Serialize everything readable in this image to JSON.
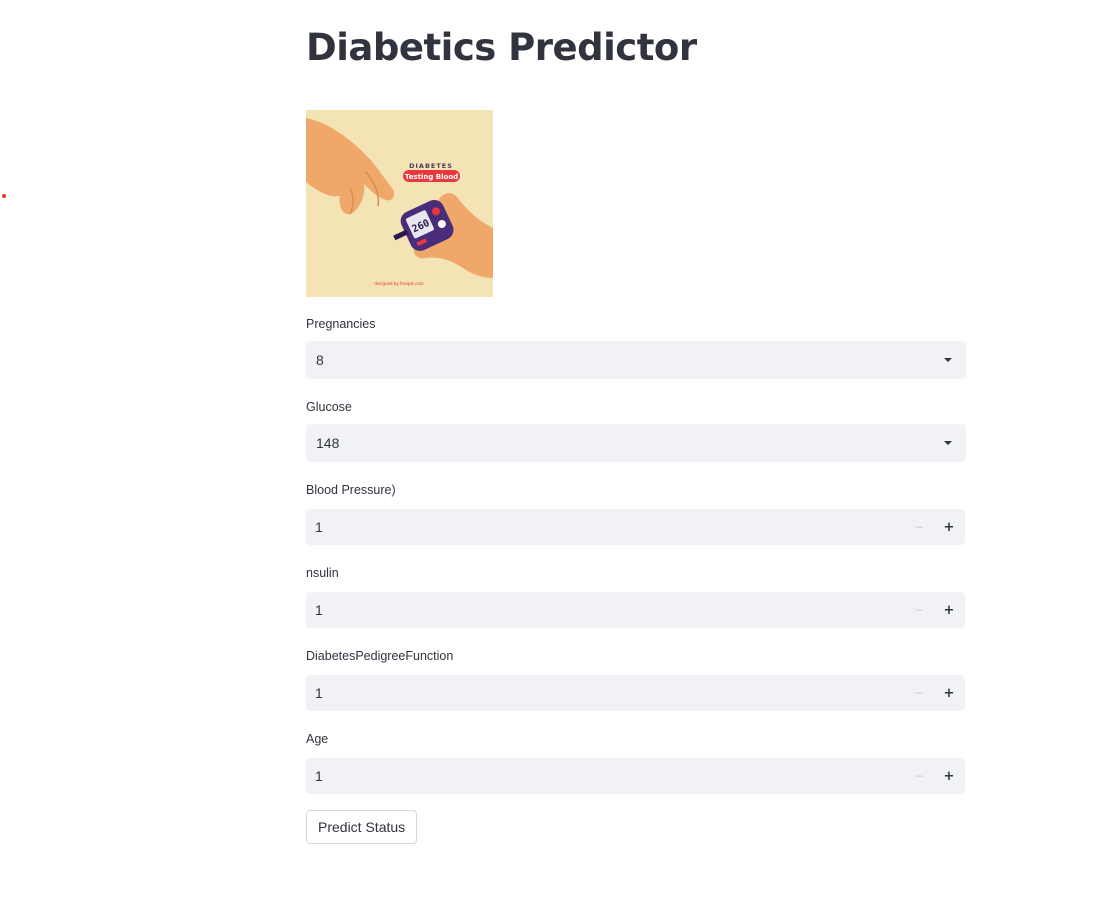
{
  "page": {
    "title": "Diabetics Predictor"
  },
  "hero_image": {
    "heading": "DIABETES",
    "badge": "Testing Blood",
    "reading": "260",
    "credit": "designed by freepik.com",
    "colors": {
      "background": "#f3e3b5",
      "skin": "#f0a86a",
      "device": "#4a2d7a",
      "badge": "#e8383d"
    }
  },
  "form": {
    "pregnancies": {
      "label": "Pregnancies",
      "value": "8",
      "type": "select"
    },
    "glucose": {
      "label": "Glucose",
      "value": "148",
      "type": "select"
    },
    "blood_pressure": {
      "label": "Blood Pressure)",
      "value": "1",
      "type": "number"
    },
    "insulin": {
      "label": "nsulin",
      "value": "1",
      "type": "number"
    },
    "dpf": {
      "label": "DiabetesPedigreeFunction",
      "value": "1",
      "type": "number"
    },
    "age": {
      "label": "Age",
      "value": "1",
      "type": "number"
    },
    "stepper_minus": "−",
    "stepper_plus": "+"
  },
  "actions": {
    "predict_label": "Predict Status"
  },
  "colors": {
    "input_bg": "#f0f2f6",
    "text": "#31333f",
    "accent_dot": "#ff2b2b"
  }
}
